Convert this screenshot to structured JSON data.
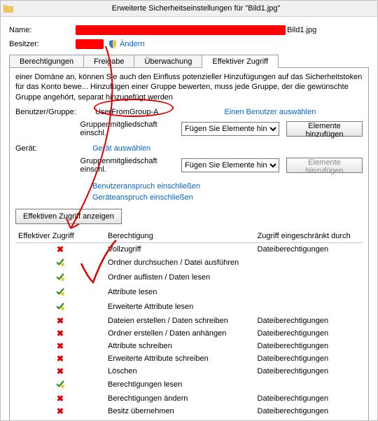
{
  "title": "Erweiterte Sicherheitseinstellungen für \"Bild1.jpg\"",
  "labels": {
    "name": "Name:",
    "owner": "Besitzer:",
    "change": "Ändern",
    "user_group": "Benutzer/Gruppe:",
    "device": "Gerät:",
    "group_membership": "Gruppenmitgliedschaft einschl.",
    "select_user": "Einen Benutzer auswählen",
    "select_device": "Gerät auswählen",
    "include_user_claim": "Benutzeranspruch einschließen",
    "include_device_claim": "Geräteanspruch einschließen",
    "show_effective": "Effektiven Zugriff anzeigen",
    "add_elements_btn": "Elemente hinzufügen",
    "file_name": "Bild1.jpg",
    "user_value": "UserFromGroup-A",
    "placeholder_add": "Fügen Sie Elemente hinzu"
  },
  "tabs": {
    "permissions": "Berechtigungen",
    "share": "Freigabe",
    "audit": "Überwachung",
    "effective": "Effektiver Zugriff"
  },
  "note_text": "einer Domäne an, können Sie auch den Einfluss potenzieller Hinzufügungen auf das Sicherheitstoken für das Konto bewe... Hinzufügen einer Gruppe bewerten, muss jede Gruppe, der die gewünschte Gruppe angehört, separat hinzugefügt werden",
  "columns": {
    "effective": "Effektiver Zugriff",
    "permission": "Berechtigung",
    "limited": "Zugriff eingeschränkt durch"
  },
  "rows": [
    {
      "ok": false,
      "perm": "Vollzugriff",
      "lim": "Dateiberechtigungen"
    },
    {
      "ok": true,
      "perm": "Ordner durchsuchen / Datei ausführen",
      "lim": ""
    },
    {
      "ok": true,
      "perm": "Ordner auflisten / Daten lesen",
      "lim": ""
    },
    {
      "ok": true,
      "perm": "Attribute lesen",
      "lim": ""
    },
    {
      "ok": true,
      "perm": "Erweiterte Attribute lesen",
      "lim": ""
    },
    {
      "ok": false,
      "perm": "Dateien erstellen / Daten schreiben",
      "lim": "Dateiberechtigungen"
    },
    {
      "ok": false,
      "perm": "Ordner erstellen / Daten anhängen",
      "lim": "Dateiberechtigungen"
    },
    {
      "ok": false,
      "perm": "Attribute schreiben",
      "lim": "Dateiberechtigungen"
    },
    {
      "ok": false,
      "perm": "Erweiterte Attribute schreiben",
      "lim": "Dateiberechtigungen"
    },
    {
      "ok": false,
      "perm": "Löschen",
      "lim": "Dateiberechtigungen"
    },
    {
      "ok": true,
      "perm": "Berechtigungen lesen",
      "lim": ""
    },
    {
      "ok": false,
      "perm": "Berechtigungen ändern",
      "lim": "Dateiberechtigungen"
    },
    {
      "ok": false,
      "perm": "Besitz übernehmen",
      "lim": "Dateiberechtigungen"
    }
  ]
}
